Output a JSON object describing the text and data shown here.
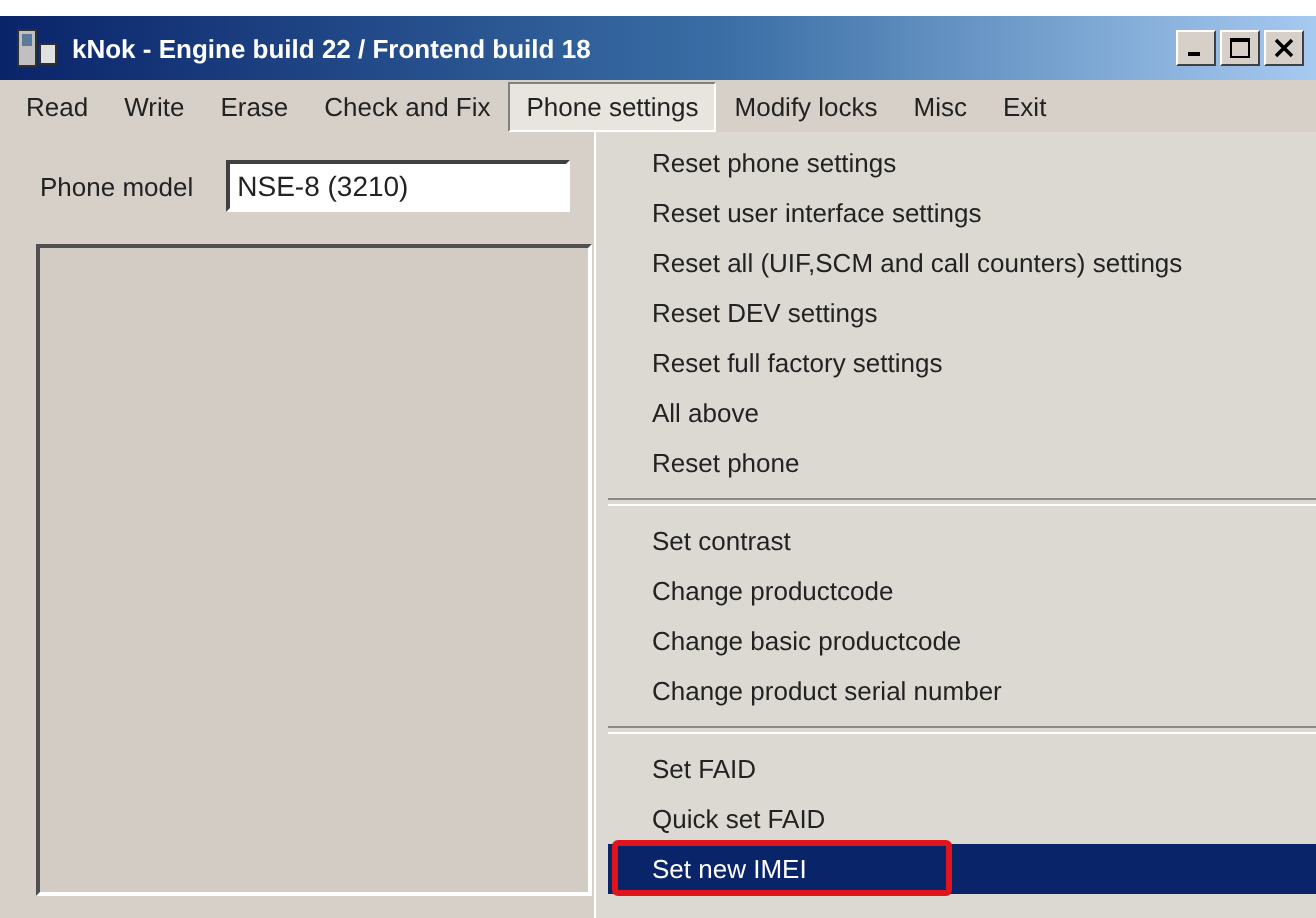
{
  "window": {
    "title": "kNok - Engine build 22 / Frontend build 18"
  },
  "menu_bar": [
    {
      "label": "Read",
      "selected": false
    },
    {
      "label": "Write",
      "selected": false
    },
    {
      "label": "Erase",
      "selected": false
    },
    {
      "label": "Check and Fix",
      "selected": false
    },
    {
      "label": "Phone settings",
      "selected": true
    },
    {
      "label": "Modify locks",
      "selected": false
    },
    {
      "label": "Misc",
      "selected": false
    },
    {
      "label": "Exit",
      "selected": false
    }
  ],
  "phone_model": {
    "label": "Phone model",
    "value": "NSE-8 (3210)"
  },
  "dropdown_menu": {
    "groups": [
      [
        {
          "label": "Reset phone settings",
          "selected": false,
          "outlined": false
        },
        {
          "label": "Reset user interface settings",
          "selected": false,
          "outlined": false
        },
        {
          "label": "Reset all (UIF,SCM and call counters) settings",
          "selected": false,
          "outlined": false
        },
        {
          "label": "Reset DEV settings",
          "selected": false,
          "outlined": false
        },
        {
          "label": "Reset full factory settings",
          "selected": false,
          "outlined": false
        },
        {
          "label": "All above",
          "selected": false,
          "outlined": false
        },
        {
          "label": "Reset phone",
          "selected": false,
          "outlined": false
        }
      ],
      [
        {
          "label": "Set contrast",
          "selected": false,
          "outlined": false
        },
        {
          "label": "Change productcode",
          "selected": false,
          "outlined": false
        },
        {
          "label": "Change basic productcode",
          "selected": false,
          "outlined": false
        },
        {
          "label": "Change product serial number",
          "selected": false,
          "outlined": false
        }
      ],
      [
        {
          "label": "Set FAID",
          "selected": false,
          "outlined": false
        },
        {
          "label": "Quick set FAID",
          "selected": false,
          "outlined": false
        },
        {
          "label": "Set new IMEI",
          "selected": true,
          "outlined": true
        }
      ]
    ]
  }
}
